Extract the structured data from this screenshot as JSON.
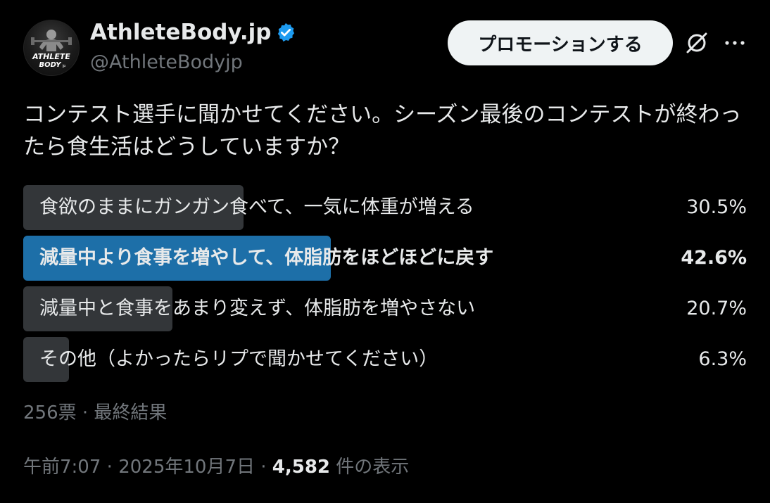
{
  "author": {
    "display_name": "AthleteBody.jp",
    "handle": "@AthleteBodyjp",
    "avatar_text_line1": "ATHLETE",
    "avatar_text_line2": "BODY",
    "avatar_text_suffix": "jp",
    "verified": true,
    "verified_color": "#1d9bf0"
  },
  "header": {
    "promote_label": "プロモーションする",
    "grok_icon": "grok-icon",
    "more_icon": "more-icon"
  },
  "post": {
    "text": "コンテスト選手に聞かせてください。シーズン最後のコンテストが終わったら食生活はどうしていますか？"
  },
  "poll": {
    "options": [
      {
        "label": "食欲のままにガンガン食べて、一気に体重が増える",
        "percent_text": "30.5%",
        "percent": 30.5,
        "winner": false
      },
      {
        "label": "減量中より食事を増やして、体脂肪をほどほどに戻す",
        "percent_text": "42.6%",
        "percent": 42.6,
        "winner": true
      },
      {
        "label": "減量中と食事をあまり変えず、体脂肪を増やさない",
        "percent_text": "20.7%",
        "percent": 20.7,
        "winner": false
      },
      {
        "label": "その他（よかったらリプで聞かせてください）",
        "percent_text": "6.3%",
        "percent": 6.3,
        "winner": false
      }
    ],
    "meta": "256票 · 最終結果"
  },
  "footer": {
    "time": "午前7:07",
    "separator": " · ",
    "date": "2025年10月7日",
    "views_count": "4,582",
    "views_label": " 件の表示"
  },
  "colors": {
    "background": "#000000",
    "text": "#e7e9ea",
    "muted": "#71767b",
    "bar": "#333639",
    "winner_bar": "#1d6fa8",
    "button_bg": "#eff3f4"
  }
}
